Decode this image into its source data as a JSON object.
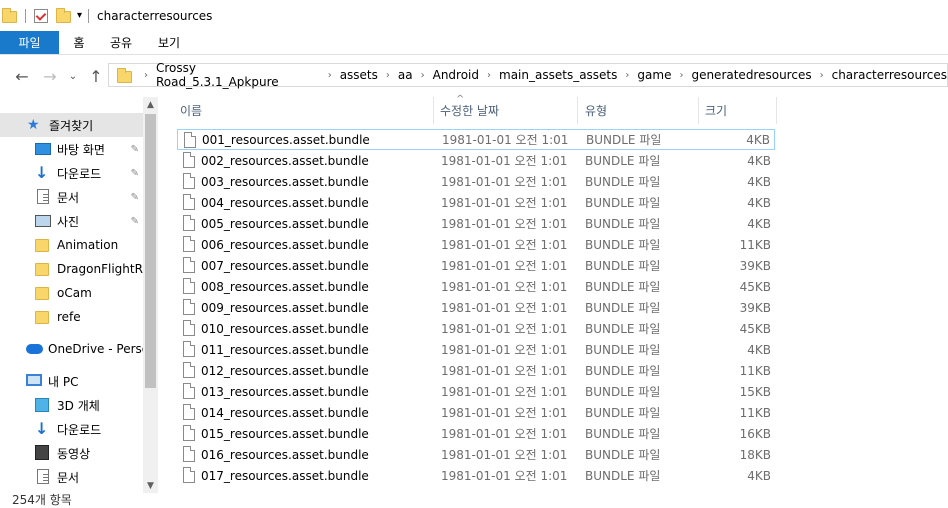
{
  "window": {
    "title": "characterresources"
  },
  "ribbon": {
    "tabs": [
      "파일",
      "홈",
      "공유",
      "보기"
    ]
  },
  "nav": {
    "back": "←",
    "forward": "→",
    "recent": "⌄",
    "up": "↑"
  },
  "breadcrumb": [
    "Crossy Road_5.3.1_Apkpure",
    "assets",
    "aa",
    "Android",
    "main_assets_assets",
    "game",
    "generatedresources",
    "characterresources"
  ],
  "sidebar": {
    "items": [
      {
        "label": "즐겨찾기",
        "icon": "star-icon",
        "pinned": false
      },
      {
        "label": "바탕 화면",
        "icon": "desktop-icon",
        "pinned": true
      },
      {
        "label": "다운로드",
        "icon": "download-icon",
        "pinned": true
      },
      {
        "label": "문서",
        "icon": "document-icon",
        "pinned": true
      },
      {
        "label": "사진",
        "icon": "pictures-icon",
        "pinned": true
      },
      {
        "label": "Animation",
        "icon": "folder-icon",
        "pinned": false
      },
      {
        "label": "DragonFlightRes",
        "icon": "folder-icon",
        "pinned": false
      },
      {
        "label": "oCam",
        "icon": "folder-icon",
        "pinned": false
      },
      {
        "label": "refe",
        "icon": "folder-icon",
        "pinned": false
      },
      {
        "label": "OneDrive - Persor",
        "icon": "onedrive-icon",
        "pinned": false
      },
      {
        "label": "내 PC",
        "icon": "pc-icon",
        "pinned": false
      },
      {
        "label": "3D 개체",
        "icon": "3d-objects-icon",
        "pinned": false
      },
      {
        "label": "다운로드",
        "icon": "download-icon",
        "pinned": false
      },
      {
        "label": "동영상",
        "icon": "video-icon",
        "pinned": false
      },
      {
        "label": "문서",
        "icon": "document-icon",
        "pinned": false
      }
    ]
  },
  "status": {
    "text": "254개 항목"
  },
  "columns": {
    "name": "이름",
    "date": "수정한 날짜",
    "type": "유형",
    "size": "크기"
  },
  "files": [
    {
      "name": "001_resources.asset.bundle",
      "date": "1981-01-01 오전 1:01",
      "type": "BUNDLE 파일",
      "size": "4KB"
    },
    {
      "name": "002_resources.asset.bundle",
      "date": "1981-01-01 오전 1:01",
      "type": "BUNDLE 파일",
      "size": "4KB"
    },
    {
      "name": "003_resources.asset.bundle",
      "date": "1981-01-01 오전 1:01",
      "type": "BUNDLE 파일",
      "size": "4KB"
    },
    {
      "name": "004_resources.asset.bundle",
      "date": "1981-01-01 오전 1:01",
      "type": "BUNDLE 파일",
      "size": "4KB"
    },
    {
      "name": "005_resources.asset.bundle",
      "date": "1981-01-01 오전 1:01",
      "type": "BUNDLE 파일",
      "size": "4KB"
    },
    {
      "name": "006_resources.asset.bundle",
      "date": "1981-01-01 오전 1:01",
      "type": "BUNDLE 파일",
      "size": "11KB"
    },
    {
      "name": "007_resources.asset.bundle",
      "date": "1981-01-01 오전 1:01",
      "type": "BUNDLE 파일",
      "size": "39KB"
    },
    {
      "name": "008_resources.asset.bundle",
      "date": "1981-01-01 오전 1:01",
      "type": "BUNDLE 파일",
      "size": "45KB"
    },
    {
      "name": "009_resources.asset.bundle",
      "date": "1981-01-01 오전 1:01",
      "type": "BUNDLE 파일",
      "size": "39KB"
    },
    {
      "name": "010_resources.asset.bundle",
      "date": "1981-01-01 오전 1:01",
      "type": "BUNDLE 파일",
      "size": "45KB"
    },
    {
      "name": "011_resources.asset.bundle",
      "date": "1981-01-01 오전 1:01",
      "type": "BUNDLE 파일",
      "size": "4KB"
    },
    {
      "name": "012_resources.asset.bundle",
      "date": "1981-01-01 오전 1:01",
      "type": "BUNDLE 파일",
      "size": "11KB"
    },
    {
      "name": "013_resources.asset.bundle",
      "date": "1981-01-01 오전 1:01",
      "type": "BUNDLE 파일",
      "size": "15KB"
    },
    {
      "name": "014_resources.asset.bundle",
      "date": "1981-01-01 오전 1:01",
      "type": "BUNDLE 파일",
      "size": "11KB"
    },
    {
      "name": "015_resources.asset.bundle",
      "date": "1981-01-01 오전 1:01",
      "type": "BUNDLE 파일",
      "size": "16KB"
    },
    {
      "name": "016_resources.asset.bundle",
      "date": "1981-01-01 오전 1:01",
      "type": "BUNDLE 파일",
      "size": "18KB"
    },
    {
      "name": "017_resources.asset.bundle",
      "date": "1981-01-01 오전 1:01",
      "type": "BUNDLE 파일",
      "size": "4KB"
    }
  ],
  "colors": {
    "file_tab": "#1979ca",
    "focus_border": "#99d1ff",
    "selected_bg": "#e5e5e5",
    "header_text": "#4c607a",
    "meta_text": "#6d6d6d"
  }
}
